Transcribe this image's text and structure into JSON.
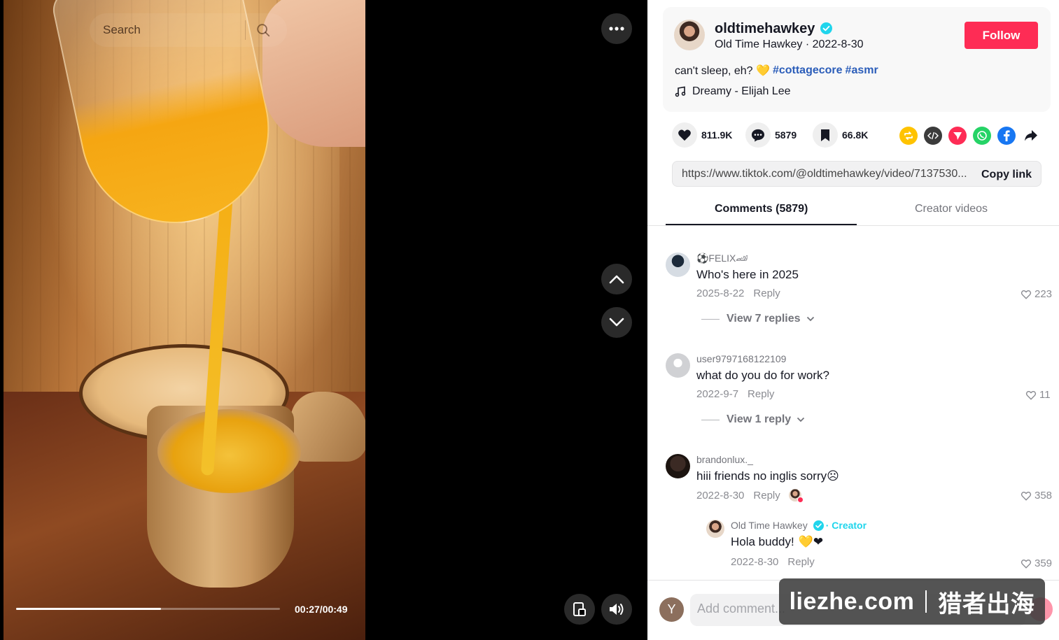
{
  "video": {
    "search_placeholder": "Search",
    "current_time": "00:27",
    "duration": "00:49",
    "time_label": "00:27/00:49",
    "progress_fraction": 0.55
  },
  "author": {
    "username": "oldtimehawkey",
    "subtitle": "Old Time Hawkey · 2022-8-30",
    "follow_label": "Follow",
    "caption_text": "can't sleep, eh? 💛",
    "hashtags": [
      "#cottagecore",
      "#asmr"
    ],
    "music": "Dreamy - Elijah Lee"
  },
  "actions": {
    "likes": "811.9K",
    "comments": "5879",
    "saves": "66.8K"
  },
  "share_icons": [
    "repost-icon",
    "embed-icon",
    "send-to-friends-icon",
    "whatsapp-icon",
    "facebook-icon",
    "share-arrow-icon"
  ],
  "link": {
    "url": "https://www.tiktok.com/@oldtimehawkey/video/7137530...",
    "copy_label": "Copy link"
  },
  "tabs": {
    "comments": "Comments (5879)",
    "creator_videos": "Creator videos"
  },
  "comments": [
    {
      "user": "⚽FELIX🏎",
      "text": "Who's here in 2025",
      "date": "2025-8-22",
      "reply": "Reply",
      "likes": "223",
      "view_replies": "View 7 replies"
    },
    {
      "user": "user9797168122109",
      "text": "what do you do for work?",
      "date": "2022-9-7",
      "reply": "Reply",
      "likes": "11",
      "view_replies": "View 1 reply"
    },
    {
      "user": "brandonlux._",
      "text": "hiii friends no inglis sorry",
      "emoji": "☹",
      "date": "2022-8-30",
      "reply": "Reply",
      "likes": "358"
    }
  ],
  "creator_reply": {
    "user": "Old Time Hawkey",
    "creator_tag": "· Creator",
    "text": "Hola buddy!",
    "emoji": "💛❤",
    "date": "2022-8-30",
    "reply": "Reply",
    "likes": "359"
  },
  "bottom": {
    "me_initial": "Y",
    "comment_placeholder": "Add comment..."
  },
  "watermark": {
    "left": "liezhe.com",
    "right": "猎者出海"
  },
  "colors": {
    "follow": "#fe2c55",
    "hashtag": "#2b5db9",
    "creator": "#20d5ec",
    "verified": "#20d5ec"
  }
}
